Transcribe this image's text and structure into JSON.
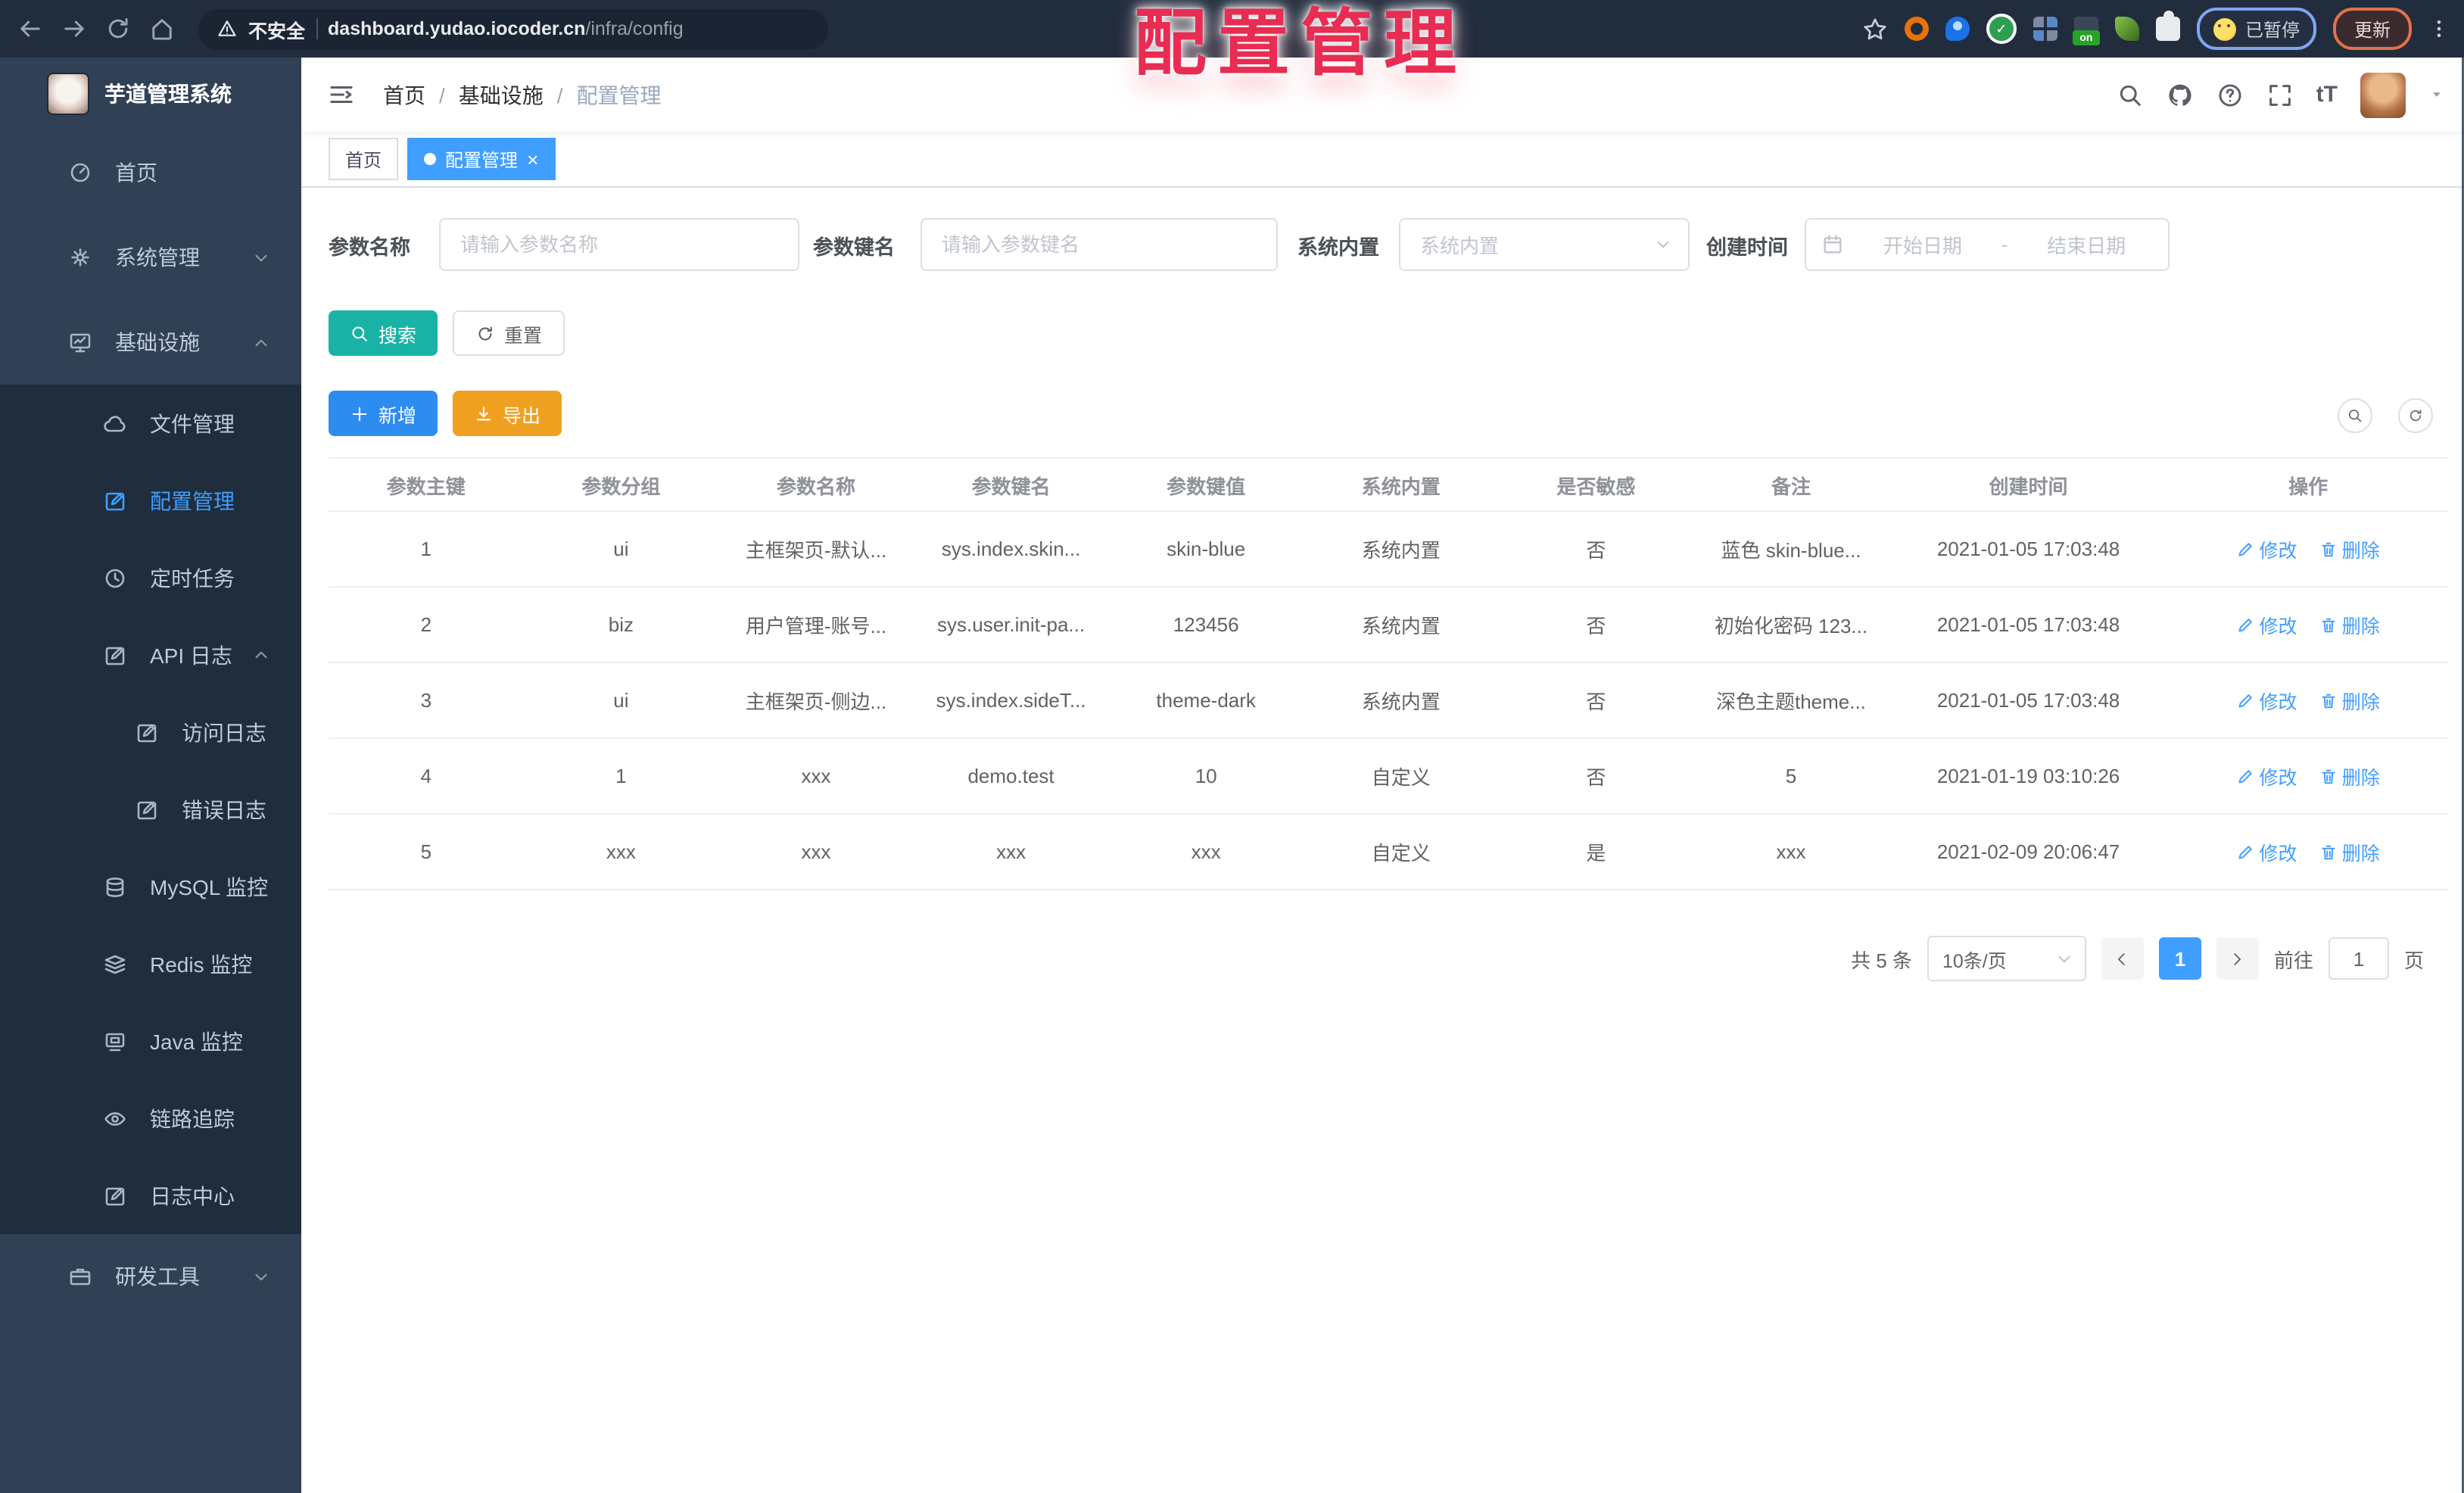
{
  "browser": {
    "security_label": "不安全",
    "url_host": "dashboard.yudao.iocoder.cn",
    "url_path": "/infra/config",
    "extension_on_label": "on",
    "paused_badge": "已暂停",
    "update_button": "更新"
  },
  "overlay": {
    "title": "配置管理"
  },
  "sidebar": {
    "app_title": "芋道管理系统",
    "items": [
      "首页",
      "系统管理",
      "基础设施",
      "文件管理",
      "配置管理",
      "定时任务",
      "API 日志",
      "访问日志",
      "错误日志",
      "MySQL 监控",
      "Redis 监控",
      "Java 监控",
      "链路追踪",
      "日志中心",
      "研发工具"
    ]
  },
  "breadcrumb": {
    "items": [
      "首页",
      "基础设施",
      "配置管理"
    ],
    "separator": "/"
  },
  "tags": {
    "items": [
      {
        "label": "首页"
      },
      {
        "label": "配置管理"
      }
    ]
  },
  "icons": {
    "close": "×",
    "question": "?",
    "font_size": "tT",
    "check": "✓"
  },
  "filters": {
    "name_label": "参数名称",
    "name_placeholder": "请输入参数名称",
    "key_label": "参数键名",
    "key_placeholder": "请输入参数键名",
    "type_label": "系统内置",
    "type_placeholder": "系统内置",
    "date_label": "创建时间",
    "date_start_placeholder": "开始日期",
    "date_separator": "-",
    "date_end_placeholder": "结束日期",
    "search_button": "搜索",
    "reset_button": "重置"
  },
  "toolbar": {
    "add_button": "新增",
    "export_button": "导出"
  },
  "table": {
    "headers": [
      "参数主键",
      "参数分组",
      "参数名称",
      "参数键名",
      "参数键值",
      "系统内置",
      "是否敏感",
      "备注",
      "创建时间",
      "操作"
    ],
    "rows": [
      [
        "1",
        "ui",
        "主框架页-默认...",
        "sys.index.skin...",
        "skin-blue",
        "系统内置",
        "否",
        "蓝色 skin-blue...",
        "2021-01-05 17:03:48"
      ],
      [
        "2",
        "biz",
        "用户管理-账号...",
        "sys.user.init-pa...",
        "123456",
        "系统内置",
        "否",
        "初始化密码 123...",
        "2021-01-05 17:03:48"
      ],
      [
        "3",
        "ui",
        "主框架页-侧边...",
        "sys.index.sideT...",
        "theme-dark",
        "系统内置",
        "否",
        "深色主题theme...",
        "2021-01-05 17:03:48"
      ],
      [
        "4",
        "1",
        "xxx",
        "demo.test",
        "10",
        "自定义",
        "否",
        "5",
        "2021-01-19 03:10:26"
      ],
      [
        "5",
        "xxx",
        "xxx",
        "xxx",
        "xxx",
        "自定义",
        "是",
        "xxx",
        "2021-02-09 20:06:47"
      ]
    ],
    "edit_action": "修改",
    "delete_action": "删除"
  },
  "pagination": {
    "total_text": "共 5 条",
    "page_size": "10条/页",
    "current_page": "1",
    "goto_label": "前往",
    "goto_value": "1",
    "page_unit": "页"
  },
  "colors": {
    "primary": "#409eff",
    "search_button": "#18b3a4",
    "add_button": "#2d8cf0",
    "export_button": "#f0a020",
    "sidebar_bg": "#304156",
    "submenu_bg": "#1f2d3d",
    "chrome_bg": "#212c3d",
    "overlay_red": "#e82c52"
  }
}
